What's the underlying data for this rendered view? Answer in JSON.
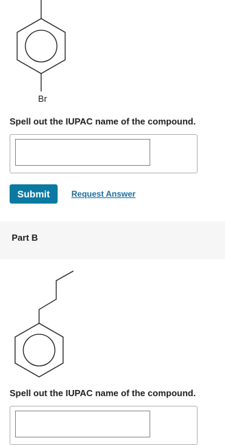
{
  "part_a": {
    "substituent_label": "Br",
    "question": "Spell out the IUPAC name of the compound.",
    "input_value": "",
    "submit_label": "Submit",
    "request_answer_label": "Request Answer"
  },
  "part_b": {
    "title": "Part B",
    "question": "Spell out the IUPAC name of the compound.",
    "input_value": ""
  },
  "colors": {
    "submit_bg": "#0b7aa2",
    "link": "#1a6e9c",
    "part_header_bg": "#f6f6f6"
  }
}
